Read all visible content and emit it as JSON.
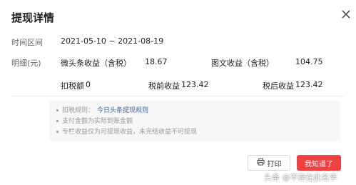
{
  "dialog": {
    "title": "提现详情",
    "close_icon": "close-icon"
  },
  "time_range": {
    "label": "时间区间",
    "value": "2021-05-10 ~ 2021-08-19"
  },
  "detail": {
    "label": "明细(元)",
    "items": [
      {
        "label": "微头条收益（含税）",
        "value": "18.67"
      },
      {
        "label": "图文收益（含税）",
        "value": "104.75"
      }
    ],
    "tax": {
      "label": "扣税额",
      "value": "0"
    },
    "pre_tax": {
      "label": "税前收益",
      "value": "123.42"
    },
    "post_tax": {
      "label": "税后收益",
      "value": "123.42"
    }
  },
  "rules": {
    "rule1_prefix": "扣税规则：",
    "rule1_link": "今日头条提现规则",
    "rule2": "支付金额为实际到账金额",
    "rule3": "专栏收益仅为可提现收益，未完结收益不可提现"
  },
  "buttons": {
    "print_label": "打印",
    "print_icon": "printer-icon",
    "ok_label": "我知道了"
  },
  "watermark": "头条 @不存在此名字",
  "colors": {
    "accent": "#f04142",
    "link": "#406599"
  }
}
